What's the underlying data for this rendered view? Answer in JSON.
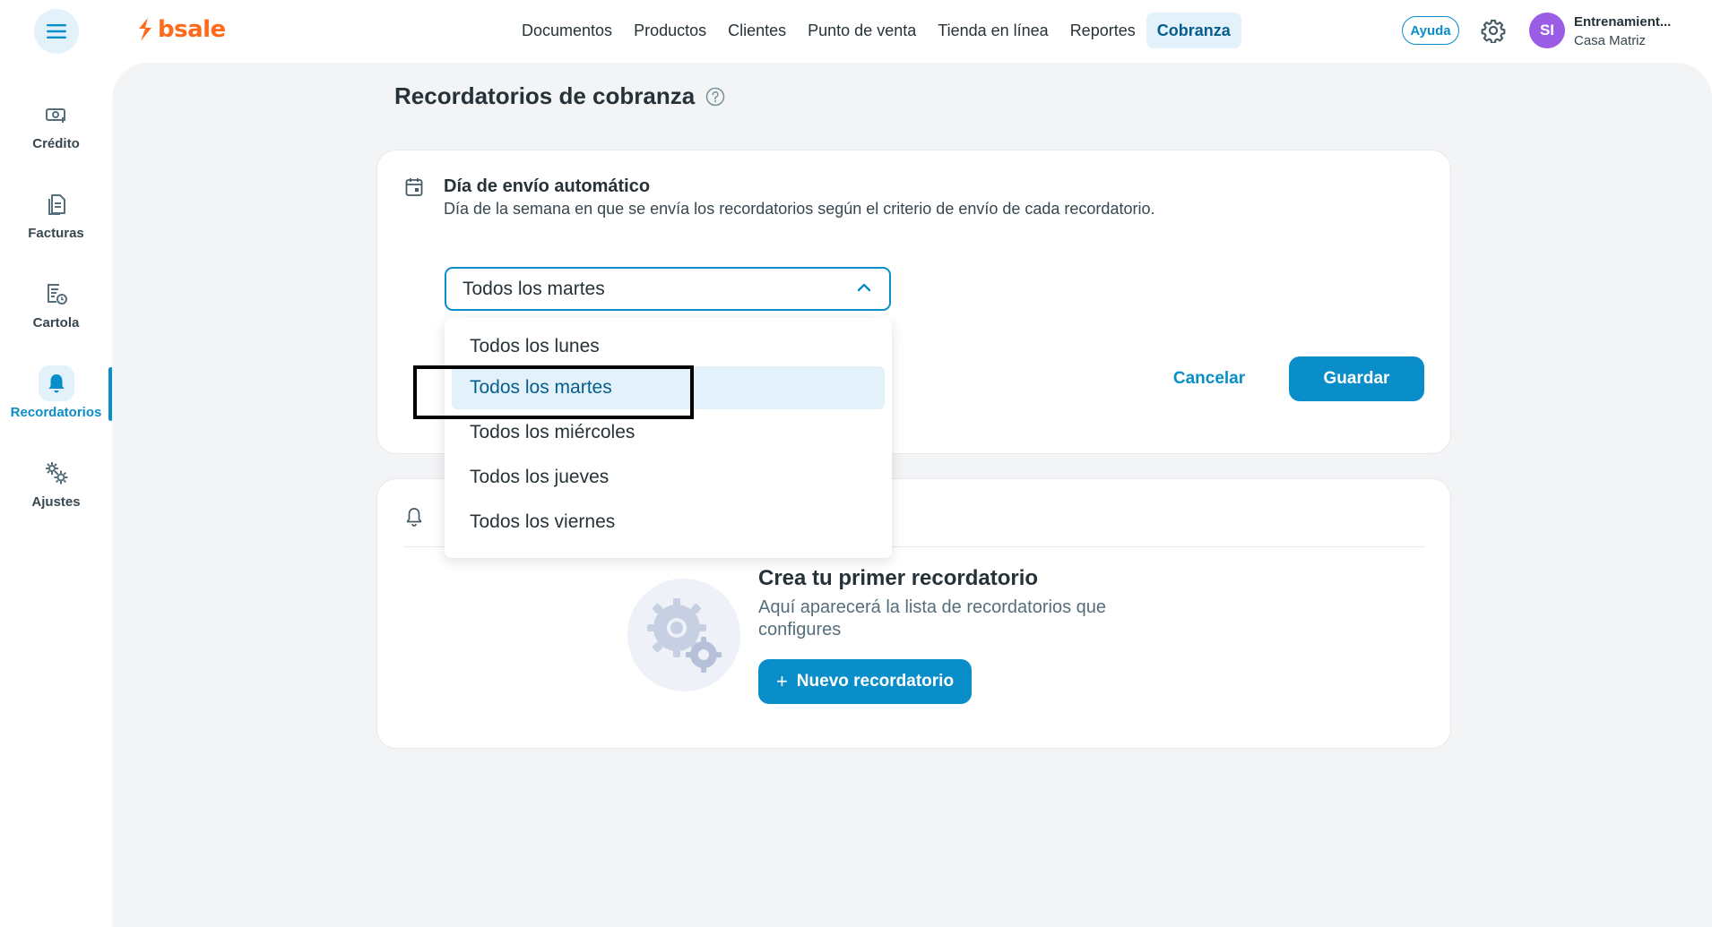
{
  "app": {
    "logo_text": "bsale",
    "brand_color": "#ff6a1a",
    "accent_color": "#0a8ec9"
  },
  "nav": {
    "items": [
      {
        "label": "Documentos"
      },
      {
        "label": "Productos"
      },
      {
        "label": "Clientes"
      },
      {
        "label": "Punto de venta"
      },
      {
        "label": "Tienda en línea"
      },
      {
        "label": "Reportes"
      },
      {
        "label": "Cobranza",
        "active": true
      }
    ]
  },
  "header": {
    "help_label": "Ayuda",
    "avatar_initials": "SI",
    "user_name": "Entrenamient...",
    "branch": "Casa Matriz"
  },
  "sidebar": {
    "items": [
      {
        "label": "Crédito",
        "icon": "money-icon"
      },
      {
        "label": "Facturas",
        "icon": "documents-icon"
      },
      {
        "label": "Cartola",
        "icon": "statement-clock-icon"
      },
      {
        "label": "Recordatorios",
        "icon": "bell-icon",
        "active": true
      },
      {
        "label": "Ajustes",
        "icon": "gears-icon"
      }
    ]
  },
  "page": {
    "title": "Recordatorios de cobranza"
  },
  "auto_send": {
    "title": "Día de envío automático",
    "description": "Día de la semana en que se envía los recordatorios según el criterio de envío de cada recordatorio.",
    "selected_value": "Todos los martes",
    "options": [
      "Todos los lunes",
      "Todos los martes",
      "Todos los miércoles",
      "Todos los jueves",
      "Todos los viernes"
    ],
    "cancel_label": "Cancelar",
    "save_label": "Guardar"
  },
  "reminders": {
    "empty_title": "Crea tu primer recordatorio",
    "empty_desc": "Aquí aparecerá la lista de recordatorios que configures",
    "new_button_icon": "+",
    "new_button_label": "Nuevo recordatorio"
  }
}
